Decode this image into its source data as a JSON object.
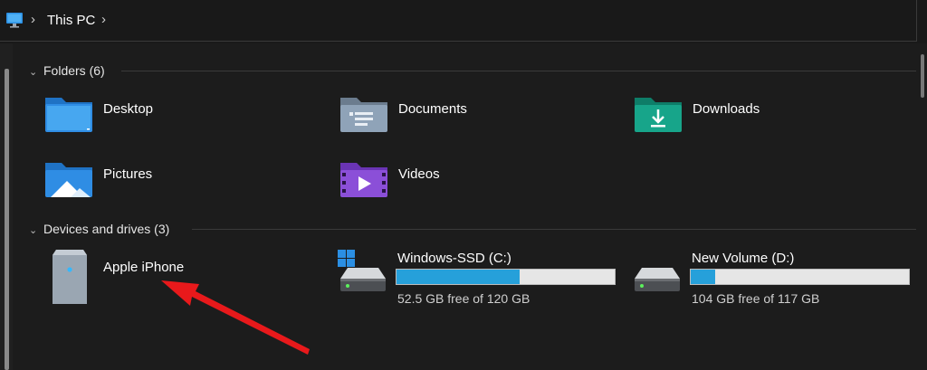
{
  "addressbar": {
    "breadcrumb": "This PC",
    "icon": "computer-icon"
  },
  "sections": {
    "folders": {
      "title": "Folders (6)"
    },
    "devices": {
      "title": "Devices and drives (3)"
    }
  },
  "folders": [
    {
      "name": "Desktop",
      "icon": "desktop-folder-icon",
      "color": "#2f8de4"
    },
    {
      "name": "Documents",
      "icon": "documents-folder-icon",
      "color": "#8fa3b8"
    },
    {
      "name": "Downloads",
      "icon": "downloads-folder-icon",
      "color": "#17a58a"
    },
    {
      "name": "Pictures",
      "icon": "pictures-folder-icon",
      "color": "#2f8de4"
    },
    {
      "name": "Videos",
      "icon": "videos-folder-icon",
      "color": "#8b4fd8"
    }
  ],
  "devices": [
    {
      "name": "Apple iPhone",
      "icon": "iphone-device-icon"
    },
    {
      "name": "Windows-SSD (C:)",
      "free_text": "52.5 GB free of 120 GB",
      "used_fraction": 0.5625,
      "icon": "windows-drive-icon"
    },
    {
      "name": "New Volume (D:)",
      "free_text": "104 GB free of 117 GB",
      "used_fraction": 0.111,
      "icon": "drive-icon"
    }
  ],
  "colors": {
    "accent": "#26a0da",
    "annotation": "#e8191b"
  }
}
